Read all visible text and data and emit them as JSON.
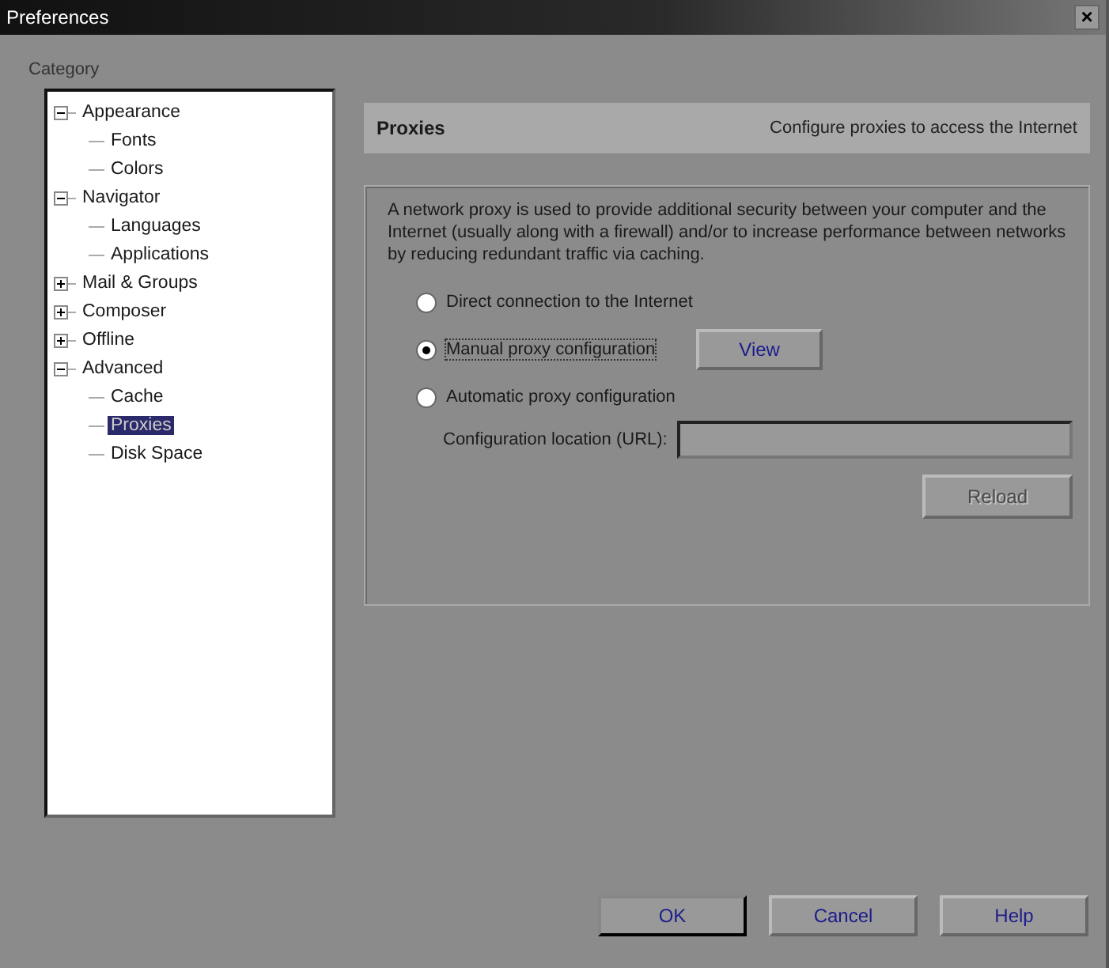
{
  "window": {
    "title": "Preferences",
    "close": "×"
  },
  "category_label": "Category",
  "tree": [
    {
      "label": "Appearance",
      "expanded": true,
      "selected": false,
      "children": [
        {
          "label": "Fonts",
          "selected": false
        },
        {
          "label": "Colors",
          "selected": false
        }
      ]
    },
    {
      "label": "Navigator",
      "expanded": true,
      "selected": false,
      "children": [
        {
          "label": "Languages",
          "selected": false
        },
        {
          "label": "Applications",
          "selected": false
        }
      ]
    },
    {
      "label": "Mail & Groups",
      "expanded": false,
      "selected": false
    },
    {
      "label": "Composer",
      "expanded": false,
      "selected": false
    },
    {
      "label": "Offline",
      "expanded": false,
      "selected": false
    },
    {
      "label": "Advanced",
      "expanded": true,
      "selected": false,
      "children": [
        {
          "label": "Cache",
          "selected": false
        },
        {
          "label": "Proxies",
          "selected": true
        },
        {
          "label": "Disk Space",
          "selected": false
        }
      ]
    }
  ],
  "header": {
    "title": "Proxies",
    "description": "Configure proxies to access the Internet"
  },
  "description": "A network proxy is used to provide additional security between your computer and the Internet (usually along with a firewall) and/or to increase performance between networks by reducing redundant traffic via caching.",
  "options": [
    {
      "label": "Direct connection to the Internet",
      "selected": false
    },
    {
      "label": "Manual proxy configuration",
      "selected": true,
      "button": "View"
    },
    {
      "label": "Automatic proxy configuration",
      "selected": false
    }
  ],
  "url_field": {
    "label": "Configuration location (URL):"
  },
  "reload_button": {
    "label": "Reload",
    "disabled": true
  },
  "buttons": [
    "OK",
    "Cancel",
    "Help"
  ]
}
